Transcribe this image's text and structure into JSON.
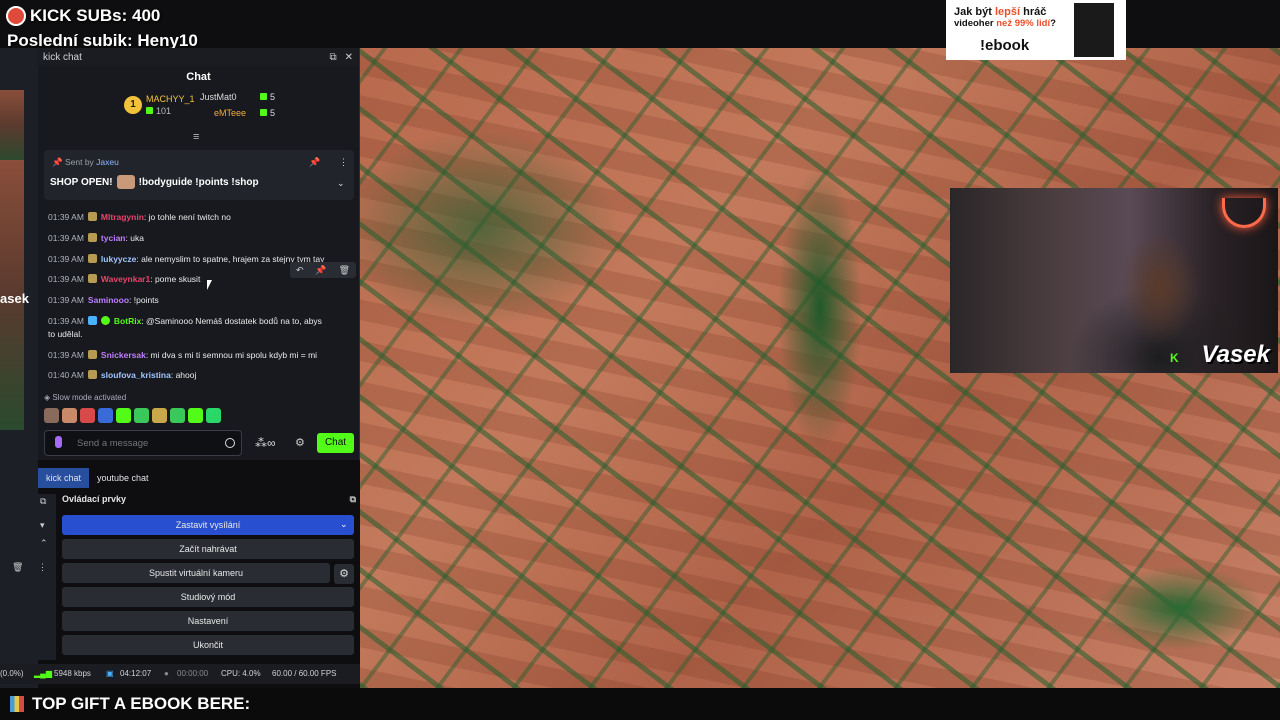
{
  "overlay": {
    "kick_subs": "KICK SUBs: 400",
    "last_sub": "Poslední subik: Heny10",
    "left_name": "asek"
  },
  "chat_dock": {
    "title": "kick chat",
    "header": "Chat",
    "leaderboard": [
      {
        "rank": "1",
        "name": "MACHYY_1",
        "count": "101"
      },
      {
        "name": "JustMat0",
        "count": "5"
      },
      {
        "name": "eMTeee",
        "count": "5"
      }
    ],
    "pinned": {
      "sent_by_label": "Sent by",
      "sent_by_user": "Jaxeu",
      "text_a": "SHOP OPEN!",
      "text_b": "!bodyguide !points !shop"
    },
    "messages": [
      {
        "time": "01:39 AM",
        "user": "Mltragynin",
        "color": "#e5466b",
        "text": ": jo tohle není twitch no"
      },
      {
        "time": "01:39 AM",
        "user": "tycian",
        "color": "#c07fff",
        "text": ": uka"
      },
      {
        "time": "01:39 AM",
        "user": "lukyycze",
        "color": "#9fc6ff",
        "text": ": ale nemyslim to spatne, hrajem za stejny tym tay"
      },
      {
        "time": "01:39 AM",
        "user": "Waveynkar1",
        "color": "#e5466b",
        "text": ": pome skusit"
      },
      {
        "time": "01:39 AM",
        "user": "Saminooo",
        "color": "#c07fff",
        "text": ": !points"
      },
      {
        "time": "01:39 AM",
        "user": "BotRix",
        "color": "#53fc18",
        "text": ": @Saminooo Nemáš dostatek bodů na to, abys"
      },
      {
        "time": "",
        "user": "",
        "color": "#fff",
        "text": "to udělal."
      },
      {
        "time": "01:39 AM",
        "user": "Snickersak",
        "color": "#c07fff",
        "text": ": mi dva s mi ti semnou mi spolu kdyb mi = mi"
      },
      {
        "time": "01:40 AM",
        "user": "sloufova_kristina",
        "color": "#9fc6ff",
        "text": ": ahooj"
      }
    ],
    "slow_mode": "Slow mode activated",
    "input_placeholder": "Send a message",
    "chat_button": "Chat",
    "tabs": [
      "kick chat",
      "youtube chat"
    ]
  },
  "controls": {
    "title": "Ovládací prvky",
    "buttons": [
      "Zastavit vysílání",
      "Začít nahrávat",
      "Spustit virtuální kameru",
      "Studiový mód",
      "Nastavení",
      "Ukončit"
    ]
  },
  "status_bar": {
    "dropped": "(0.0%)",
    "bitrate": "5948 kbps",
    "live_time": "04:12:07",
    "rec_time": "00:00:00",
    "cpu": "CPU: 4.0%",
    "fps": "60.00 / 60.00 FPS"
  },
  "bottom_banner": "TOP GIFT A EBOOK BERE:",
  "ebook_ad": {
    "line1_a": "Jak být ",
    "line1_hl": "lepší",
    "line1_b": " hráč",
    "line2_a": "videoher ",
    "line2_hl": "než 99% lidí",
    "line2_b": "?",
    "cta": "!ebook"
  },
  "webcam": {
    "streamer": "Vasek",
    "kick_logo": "K"
  },
  "colors": {
    "kick_green": "#53fc18",
    "primary_blue": "#284fd0",
    "tab_active": "#284f9e"
  }
}
